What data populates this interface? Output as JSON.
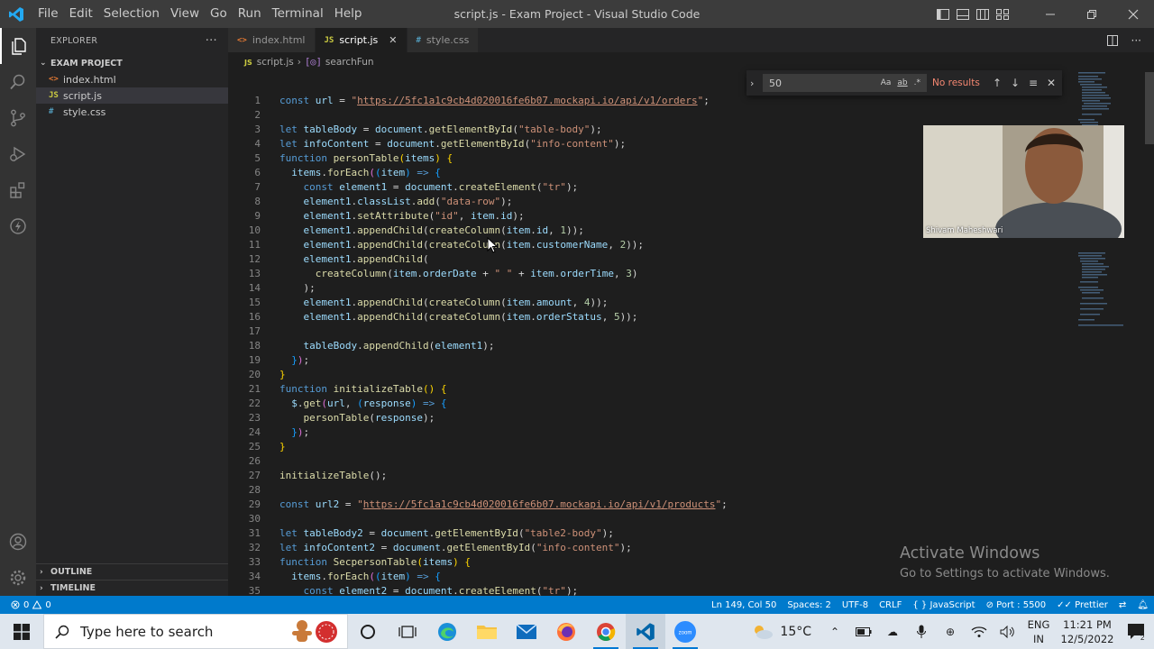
{
  "window": {
    "title": "script.js - Exam Project - Visual Studio Code",
    "menu": [
      "File",
      "Edit",
      "Selection",
      "View",
      "Go",
      "Run",
      "Terminal",
      "Help"
    ]
  },
  "sidebar": {
    "header": "EXPLORER",
    "more": "···",
    "project": "EXAM PROJECT",
    "files": [
      {
        "name": "index.html",
        "icon": "<>",
        "color": "#e37933"
      },
      {
        "name": "script.js",
        "icon": "JS",
        "color": "#cbcb41"
      },
      {
        "name": "style.css",
        "icon": "#",
        "color": "#519aba"
      }
    ],
    "outline": "OUTLINE",
    "timeline": "TIMELINE"
  },
  "tabs": [
    {
      "label": "index.html",
      "icon": "<>",
      "color": "#e37933",
      "active": false
    },
    {
      "label": "script.js",
      "icon": "JS",
      "color": "#cbcb41",
      "active": true,
      "close": "✕"
    },
    {
      "label": "style.css",
      "icon": "#",
      "color": "#519aba",
      "active": false
    }
  ],
  "breadcrumb": {
    "file": "script.js",
    "file_icon": "JS",
    "symbol": "searchFun"
  },
  "find": {
    "query": "50",
    "result": "No results",
    "opt_case": "Aa",
    "opt_word": "ab",
    "opt_regex": ".*"
  },
  "code": {
    "url1": "https://5fc1a1c9cb4d020016fe6b07.mockapi.io/api/v1/orders",
    "url2": "https://5fc1a1c9cb4d020016fe6b07.mockapi.io/api/v1/products",
    "line_numbers": [
      "1",
      "2",
      "3",
      "4",
      "5",
      "6",
      "7",
      "8",
      "9",
      "10",
      "11",
      "12",
      "13",
      "14",
      "15",
      "16",
      "17",
      "18",
      "19",
      "20",
      "21",
      "22",
      "23",
      "24",
      "25",
      "26",
      "27",
      "28",
      "29",
      "30",
      "31",
      "32",
      "33",
      "34",
      "35"
    ]
  },
  "webcam": {
    "name": "Shivam Maheshwari"
  },
  "activate": {
    "title": "Activate Windows",
    "subtitle": "Go to Settings to activate Windows."
  },
  "status": {
    "errors": "0",
    "warnings": "0",
    "position": "Ln 149, Col 50",
    "spaces": "Spaces: 2",
    "encoding": "UTF-8",
    "eol": "CRLF",
    "language": "JavaScript",
    "port": "Port : 5500",
    "prettier": "Prettier"
  },
  "taskbar": {
    "search_placeholder": "Type here to search",
    "temperature": "15°C",
    "lang_line1": "ENG",
    "lang_line2": "IN",
    "time": "11:21 PM",
    "date": "12/5/2022",
    "notification_count": "2",
    "zoom_label": "zoom"
  },
  "colors": {
    "accent": "#007acc",
    "editor_bg": "#1e1e1e",
    "titlebar_bg": "#3c3c3c"
  }
}
